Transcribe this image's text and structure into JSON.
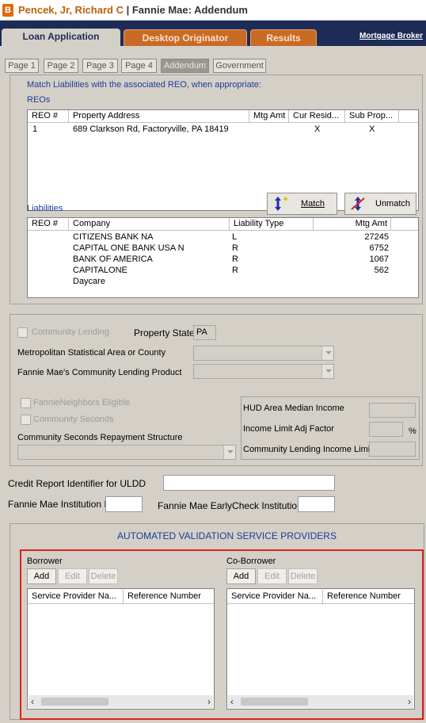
{
  "title": {
    "borrower_name": "Pencek, Jr, Richard C",
    "separator": " | ",
    "section": "Fannie Mae: Addendum",
    "app_icon_letter": "B"
  },
  "main_tabs": [
    "Loan Application",
    "Desktop Originator",
    "Results"
  ],
  "mortgage_broker_link": "Mortgage Broker",
  "page_tabs": [
    "Page 1",
    "Page 2",
    "Page 3",
    "Page 4",
    "Addendum",
    "Government"
  ],
  "reo_section": {
    "instruction": "Match Liabilities with the associated REO, when appropriate:",
    "reos_label": "REOs",
    "columns": [
      "REO #",
      "Property Address",
      "Mtg Amt",
      "Cur Resid...",
      "Sub Prop..."
    ],
    "rows": [
      {
        "reo": "1",
        "address": "689 Clarkson Rd, Factoryville, PA 18419",
        "mtg_amt": "",
        "cur_res": "X",
        "sub_prop": "X"
      }
    ],
    "match_button": "Match",
    "unmatch_button": "Unmatch",
    "liabilities_label": "Liabilities",
    "liab_columns": [
      "REO #",
      "Company",
      "Liability Type",
      "Mtg Amt"
    ],
    "liab_rows": [
      {
        "reo": "",
        "company": "CITIZENS BANK NA",
        "type": "L",
        "amt": "27245"
      },
      {
        "reo": "",
        "company": "CAPITAL ONE BANK USA N",
        "type": "R",
        "amt": "6752"
      },
      {
        "reo": "",
        "company": "BANK OF AMERICA",
        "type": "R",
        "amt": "1067"
      },
      {
        "reo": "",
        "company": "CAPITALONE",
        "type": "R",
        "amt": "562"
      },
      {
        "reo": "",
        "company": "Daycare",
        "type": "",
        "amt": ""
      }
    ]
  },
  "community": {
    "community_lending": "Community Lending",
    "property_state_label": "Property State",
    "property_state": "PA",
    "msa_label": "Metropolitan Statistical Area or County",
    "product_label": "Fannie Mae's Community Lending Product",
    "neighbors": "FannieNeighbors Eligible",
    "seconds": "Community Seconds",
    "repayment_label": "Community Seconds Repayment Structure",
    "hud_label": "HUD Area Median Income",
    "income_limit_label": "Income Limit Adj Factor",
    "percent": "%",
    "cl_income_label": "Community Lending Income Limit"
  },
  "credit": {
    "uldd_label": "Credit Report Identifier for ULDD",
    "institution_label": "Fannie Mae Institution ID",
    "earlycheck_label": "Fannie Mae EarlyCheck Institution ID"
  },
  "avs": {
    "heading": "AUTOMATED VALIDATION SERVICE PROVIDERS",
    "borrower_label": "Borrower",
    "coborrower_label": "Co-Borrower",
    "add": "Add",
    "edit": "Edit",
    "delete": "Delete",
    "columns": [
      "Service Provider Na...",
      "Reference Number"
    ]
  },
  "colors": {
    "tab_bar": "#1d2b57",
    "orange_tab": "#c86b25",
    "highlight_border": "#e0201e",
    "label_blue": "#1b3c99"
  }
}
